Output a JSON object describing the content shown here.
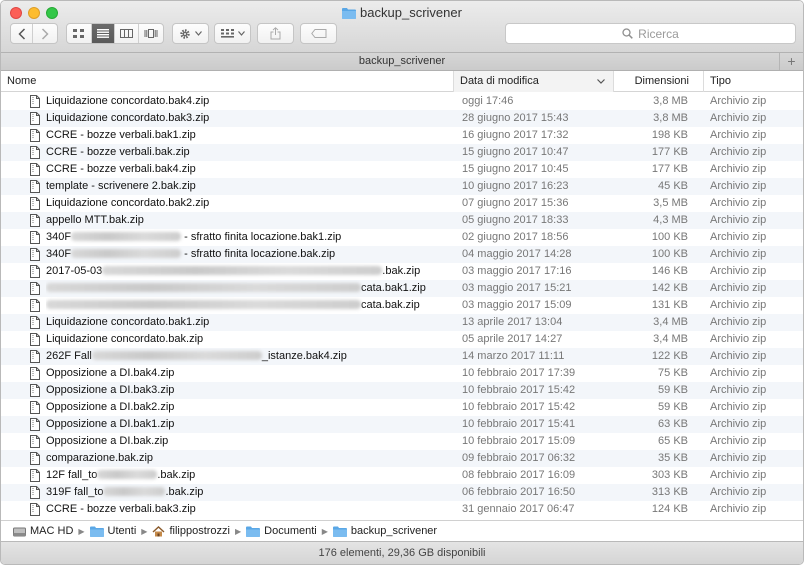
{
  "window": {
    "title": "backup_scrivener"
  },
  "toolbar": {
    "back_icon": "chevron-left-icon",
    "forward_icon": "chevron-right-icon",
    "view_modes": [
      "icon-view-icon",
      "list-view-icon",
      "column-view-icon",
      "coverflow-view-icon"
    ],
    "active_view": "list",
    "action_icon": "gear-icon",
    "arrange_icon": "arrange-grid-icon",
    "share_icon": "share-icon",
    "tag_icon": "tag-icon",
    "search_placeholder": "Ricerca"
  },
  "tabbar": {
    "label": "backup_scrivener",
    "add_label": "+"
  },
  "columns": {
    "name": "Nome",
    "date": "Data di modifica",
    "size": "Dimensioni",
    "type": "Tipo"
  },
  "files": [
    {
      "name": "Liquidazione concordato.bak4.zip",
      "date": "oggi 17:46",
      "size": "3,8 MB",
      "type": "Archivio zip"
    },
    {
      "name": "Liquidazione concordato.bak3.zip",
      "date": "28 giugno 2017 15:43",
      "size": "3,8 MB",
      "type": "Archivio zip"
    },
    {
      "name": "CCRE - bozze verbali.bak1.zip",
      "date": "16 giugno 2017 17:32",
      "size": "198 KB",
      "type": "Archivio zip"
    },
    {
      "name": "CCRE - bozze verbali.bak.zip",
      "date": "15 giugno 2017 10:47",
      "size": "177 KB",
      "type": "Archivio zip"
    },
    {
      "name": "CCRE - bozze verbali.bak4.zip",
      "date": "15 giugno 2017 10:45",
      "size": "177 KB",
      "type": "Archivio zip"
    },
    {
      "name": "template - scrivenere 2.bak.zip",
      "date": "10 giugno 2017 16:23",
      "size": "45 KB",
      "type": "Archivio zip"
    },
    {
      "name": "Liquidazione concordato.bak2.zip",
      "date": "07 giugno 2017 15:36",
      "size": "3,5 MB",
      "type": "Archivio zip"
    },
    {
      "name": "appello MTT.bak.zip",
      "date": "05 giugno 2017 18:33",
      "size": "4,3 MB",
      "type": "Archivio zip"
    },
    {
      "name_prefix": "340F",
      "name_suffix": " - sfratto finita locazione.bak1.zip",
      "blur_width": 110,
      "date": "02 giugno 2017 18:56",
      "size": "100 KB",
      "type": "Archivio zip"
    },
    {
      "name_prefix": "340F",
      "name_suffix": " - sfratto finita locazione.bak.zip",
      "blur_width": 110,
      "date": "04 maggio 2017 14:28",
      "size": "100 KB",
      "type": "Archivio zip"
    },
    {
      "name_prefix": "2017-05-03",
      "name_suffix": ".bak.zip",
      "blur_width": 280,
      "date": "03 maggio 2017 17:16",
      "size": "146 KB",
      "type": "Archivio zip"
    },
    {
      "name_prefix": "",
      "name_suffix": "cata.bak1.zip",
      "blur_width": 315,
      "date": "03 maggio 2017 15:21",
      "size": "142 KB",
      "type": "Archivio zip"
    },
    {
      "name_prefix": "",
      "name_suffix": "cata.bak.zip",
      "blur_width": 315,
      "date": "03 maggio 2017 15:09",
      "size": "131 KB",
      "type": "Archivio zip"
    },
    {
      "name": "Liquidazione concordato.bak1.zip",
      "date": "13 aprile 2017 13:04",
      "size": "3,4 MB",
      "type": "Archivio zip"
    },
    {
      "name": "Liquidazione concordato.bak.zip",
      "date": "05 aprile 2017 14:27",
      "size": "3,4 MB",
      "type": "Archivio zip"
    },
    {
      "name_prefix": "262F Fall",
      "name_suffix": "_istanze.bak4.zip",
      "blur_width": 170,
      "date": "14 marzo 2017 11:11",
      "size": "122 KB",
      "type": "Archivio zip"
    },
    {
      "name": "Opposizione a DI.bak4.zip",
      "date": "10 febbraio 2017 17:39",
      "size": "75 KB",
      "type": "Archivio zip"
    },
    {
      "name": "Opposizione a DI.bak3.zip",
      "date": "10 febbraio 2017 15:42",
      "size": "59 KB",
      "type": "Archivio zip"
    },
    {
      "name": "Opposizione a DI.bak2.zip",
      "date": "10 febbraio 2017 15:42",
      "size": "59 KB",
      "type": "Archivio zip"
    },
    {
      "name": "Opposizione a DI.bak1.zip",
      "date": "10 febbraio 2017 15:41",
      "size": "63 KB",
      "type": "Archivio zip"
    },
    {
      "name": "Opposizione a DI.bak.zip",
      "date": "10 febbraio 2017 15:09",
      "size": "65 KB",
      "type": "Archivio zip"
    },
    {
      "name": "comparazione.bak.zip",
      "date": "09 febbraio 2017 06:32",
      "size": "35 KB",
      "type": "Archivio zip"
    },
    {
      "name_prefix": "12F fall_to",
      "name_suffix": ".bak.zip",
      "blur_width": 60,
      "date": "08 febbraio 2017 16:09",
      "size": "303 KB",
      "type": "Archivio zip"
    },
    {
      "name_prefix": "319F fall_to",
      "name_suffix": ".bak.zip",
      "blur_width": 62,
      "date": "06 febbraio 2017 16:50",
      "size": "313 KB",
      "type": "Archivio zip"
    },
    {
      "name": "CCRE - bozze verbali.bak3.zip",
      "date": "31 gennaio 2017 06:47",
      "size": "124 KB",
      "type": "Archivio zip"
    }
  ],
  "pathbar": [
    {
      "label": "MAC HD",
      "icon": "hard-drive-icon"
    },
    {
      "label": "Utenti",
      "icon": "folder-icon"
    },
    {
      "label": "filippostrozzi",
      "icon": "home-icon"
    },
    {
      "label": "Documenti",
      "icon": "folder-icon"
    },
    {
      "label": "backup_scrivener",
      "icon": "folder-icon"
    }
  ],
  "status": {
    "text": "176 elementi, 29,36 GB disponibili"
  }
}
